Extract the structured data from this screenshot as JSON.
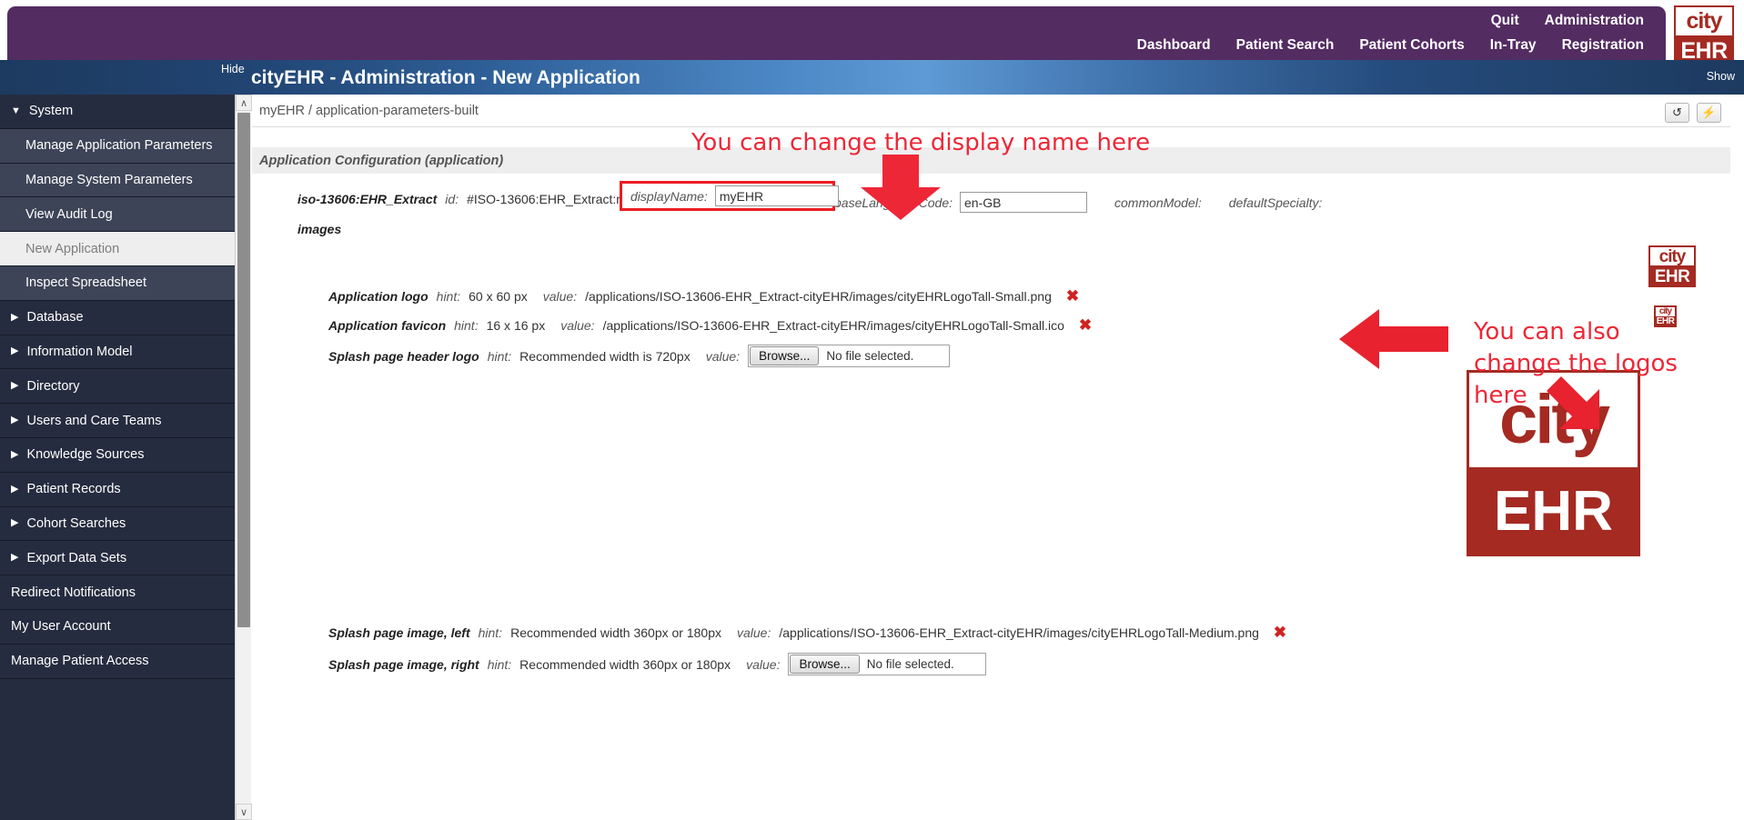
{
  "header": {
    "brand": {
      "line1": "city",
      "line2": "EHR"
    },
    "nav_top": [
      {
        "label": "Quit",
        "name": "quit"
      },
      {
        "label": "Administration",
        "name": "administration"
      }
    ],
    "nav_bottom": [
      {
        "label": "Dashboard",
        "name": "dashboard"
      },
      {
        "label": "Patient Search",
        "name": "patient-search"
      },
      {
        "label": "Patient Cohorts",
        "name": "patient-cohorts"
      },
      {
        "label": "In-Tray",
        "name": "in-tray"
      },
      {
        "label": "Registration",
        "name": "registration"
      }
    ]
  },
  "titlebar": {
    "hide_label": "Hide",
    "show_label": "Show",
    "title": "cityEHR - Administration - New Application"
  },
  "sidebar": {
    "items": [
      {
        "label": "System",
        "type": "group",
        "marker": "▼"
      },
      {
        "label": "Manage Application Parameters",
        "type": "child"
      },
      {
        "label": "Manage System Parameters",
        "type": "child"
      },
      {
        "label": "View Audit Log",
        "type": "child"
      },
      {
        "label": "New Application",
        "type": "child-active"
      },
      {
        "label": "Inspect Spreadsheet",
        "type": "child"
      },
      {
        "label": "Database",
        "type": "group",
        "marker": "▶"
      },
      {
        "label": "Information Model",
        "type": "group",
        "marker": "▶"
      },
      {
        "label": "Directory",
        "type": "group",
        "marker": "▶"
      },
      {
        "label": "Users and Care Teams",
        "type": "group",
        "marker": "▶"
      },
      {
        "label": "Knowledge Sources",
        "type": "group",
        "marker": "▶"
      },
      {
        "label": "Patient Records",
        "type": "group",
        "marker": "▶"
      },
      {
        "label": "Cohort Searches",
        "type": "group",
        "marker": "▶"
      },
      {
        "label": "Export Data Sets",
        "type": "group",
        "marker": "▶"
      },
      {
        "label": "Redirect Notifications",
        "type": "plain"
      },
      {
        "label": "My User Account",
        "type": "plain"
      },
      {
        "label": "Manage Patient Access",
        "type": "plain"
      }
    ],
    "scroll_up": "∧",
    "scroll_down": "∨"
  },
  "main": {
    "breadcrumb": "myEHR / application-parameters-built",
    "toolbar": {
      "refresh_glyph": "↺",
      "refresh_name": "refresh-icon",
      "flash_glyph": "⚡",
      "flash_name": "lightning-icon"
    },
    "config_header": "Application Configuration (application)",
    "id_row": {
      "class_label": "iso-13606:EHR_Extract",
      "id_label": "id:",
      "id_value": "#ISO-13606:EHR_Extract:myEHR",
      "displayname_label": "displayName:",
      "displayname_value": "myEHR",
      "baselanguage_label": "baseLanguageCode:",
      "baselanguage_value": "en-GB",
      "commonmodel_label": "commonModel:",
      "commonmodel_value": "",
      "defaultspecialty_label": "defaultSpecialty:",
      "defaultspecialty_value": ""
    },
    "images_label": "images",
    "hint_word": "hint:",
    "value_word": "value:",
    "no_file_text": "No file selected.",
    "browse_label": "Browse...",
    "rows": [
      {
        "name": "application-logo",
        "label": "Application logo",
        "hint": "60 x 60 px",
        "value": "/applications/ISO-13606-EHR_Extract-cityEHR/images/cityEHRLogoTall-Small.png",
        "kind": "path"
      },
      {
        "name": "application-favicon",
        "label": "Application favicon",
        "hint": "16 x 16 px",
        "value": "/applications/ISO-13606-EHR_Extract-cityEHR/images/cityEHRLogoTall-Small.ico",
        "kind": "path"
      },
      {
        "name": "splash-page-header-logo",
        "label": "Splash page header logo",
        "hint": "Recommended width is 720px",
        "value": "",
        "kind": "file"
      },
      {
        "name": "splash-page-image-left",
        "label": "Splash page image, left",
        "hint": "Recommended width 360px or 180px",
        "value": "/applications/ISO-13606-EHR_Extract-cityEHR/images/cityEHRLogoTall-Medium.png",
        "kind": "path"
      },
      {
        "name": "splash-page-image-right",
        "label": "Splash page image, right",
        "hint": "Recommended width 360px or 180px",
        "value": "",
        "kind": "file"
      }
    ],
    "delete_glyph": "✖"
  },
  "previews": {
    "logo_thumb": {
      "line1": "city",
      "line2": "EHR"
    },
    "favicon_thumb": {
      "line1": "city",
      "line2": "EHR"
    },
    "big_logo": {
      "line1": "city",
      "line2": "EHR"
    }
  },
  "annotations": {
    "display_name": "You can change the display name here",
    "logos": "You can also\nchange the logos\nhere"
  },
  "colors": {
    "topbar_purple": "#532c62",
    "titlebar_blue": "#2e5f97",
    "sidebar_dark": "#262c3f",
    "sidebar_child": "#3e4457",
    "annotation_red": "#ee2737",
    "highlight_red": "#ee1b24",
    "brand_red": "#a42a22"
  }
}
